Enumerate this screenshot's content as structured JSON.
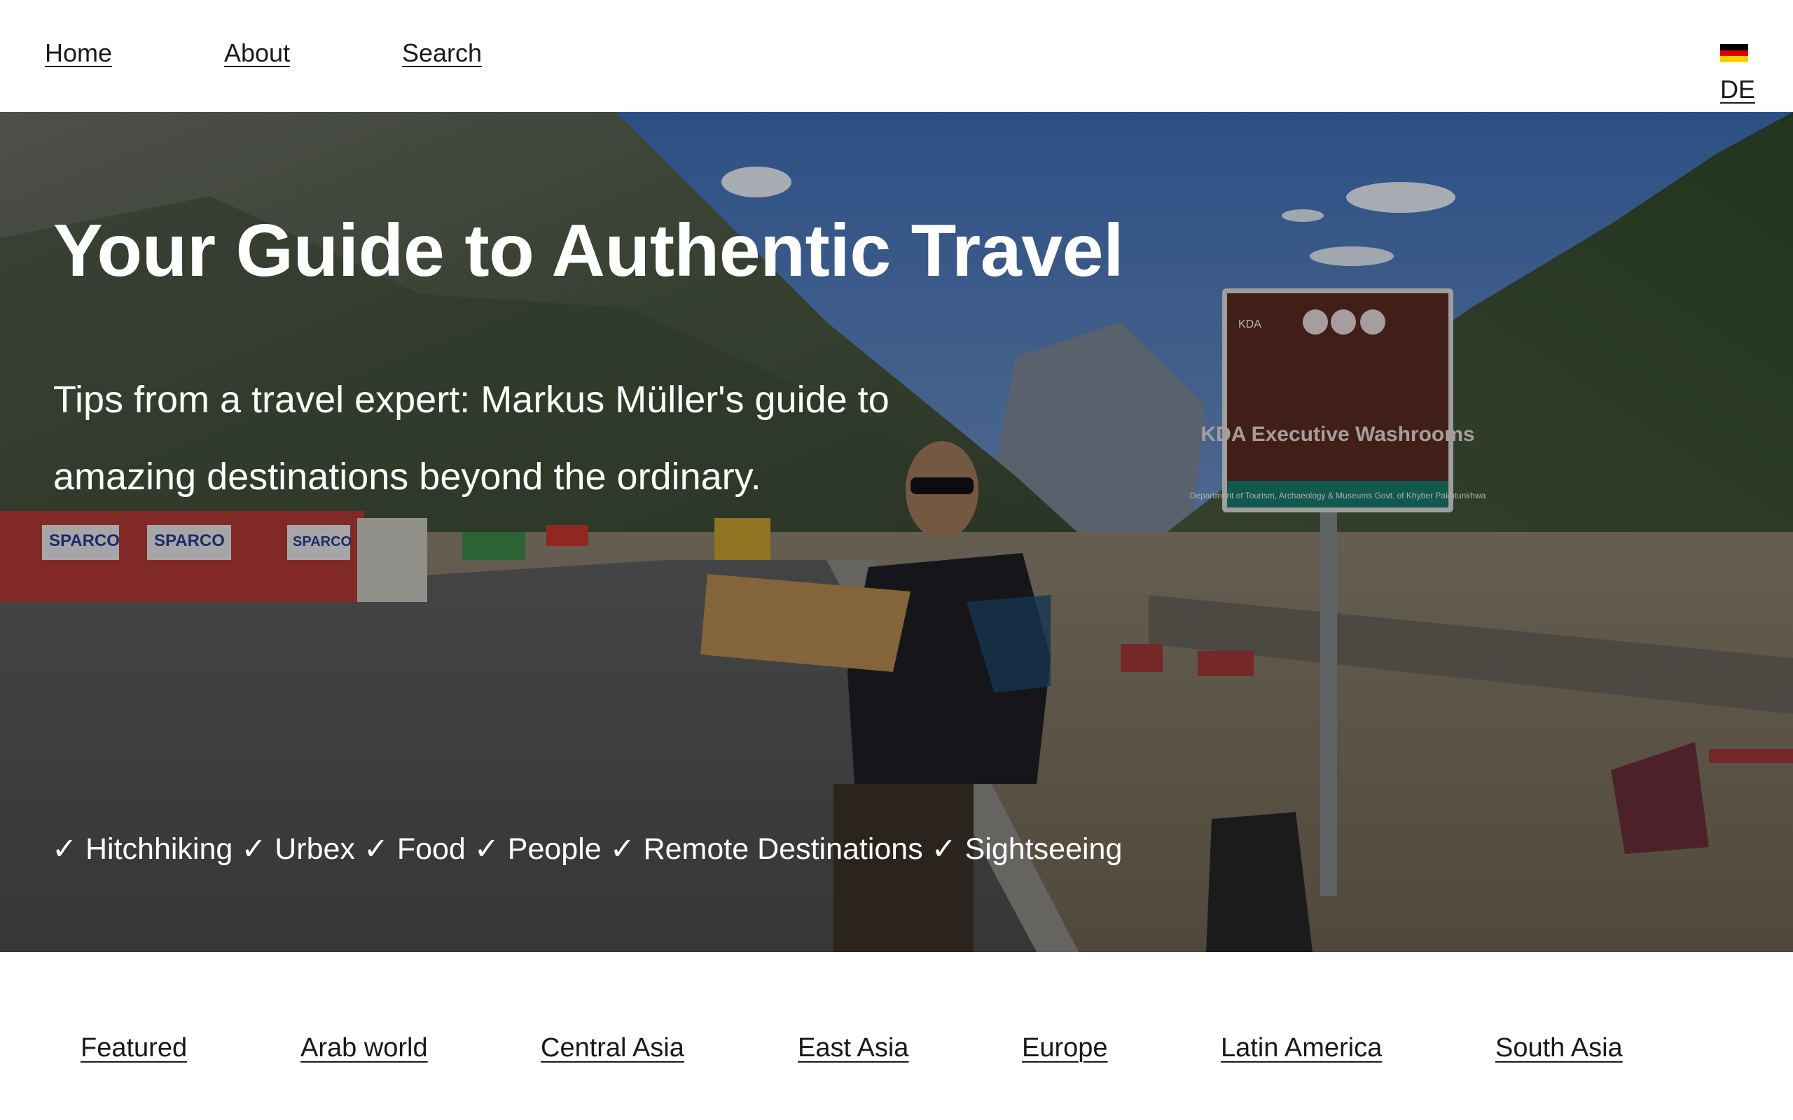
{
  "nav": {
    "home": "Home",
    "about": "About",
    "search": "Search",
    "language": "DE",
    "flag_colors": [
      "#000000",
      "#dd0000",
      "#ffce00"
    ]
  },
  "hero": {
    "title": "Your Guide to Authentic Travel",
    "subtitle": "Tips from a travel expert: Markus Müller's guide to amazing destinations beyond the ordinary.",
    "tags": "✓ Hitchhiking ✓ Urbex ✓ Food ✓ People ✓ Remote Destinations ✓ Sightseeing",
    "image": {
      "sign_title": "KDA Executive Washrooms",
      "sign_footer": "Department of Tourism, Archaeology & Museums Govt. of Khyber Pakhtunkhwa",
      "sign_badge": "KDA",
      "shop_sign": "SPARCO"
    }
  },
  "categories": [
    "Featured",
    "Arab world",
    "Central Asia",
    "East Asia",
    "Europe",
    "Latin America",
    "South Asia"
  ]
}
